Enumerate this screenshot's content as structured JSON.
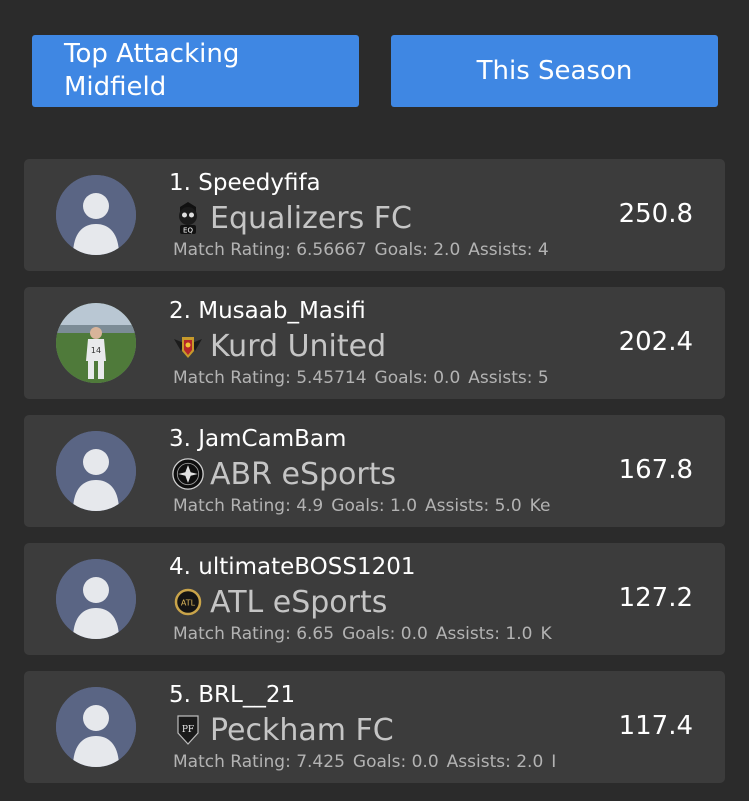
{
  "filters": {
    "position_label": "Top Attacking Midfield",
    "period_label": "This Season"
  },
  "players": [
    {
      "name": "1. Speedyfifa",
      "club": "Equalizers FC",
      "club_icon": "skull-crest-icon",
      "avatar": "default-avatar",
      "match_rating": "Match Rating: 6.56667",
      "goals": "Goals: 2.0",
      "assists": "Assists: 4",
      "score": "250.8"
    },
    {
      "name": "2. Musaab_Masifi",
      "club": "Kurd United",
      "club_icon": "winged-crest-icon",
      "avatar": "photo-avatar",
      "match_rating": "Match Rating: 5.45714",
      "goals": "Goals: 0.0",
      "assists": "Assists: 5",
      "score": "202.4"
    },
    {
      "name": "3. JamCamBam",
      "club": "ABR eSports",
      "club_icon": "round-black-crest-icon",
      "avatar": "default-avatar",
      "match_rating": "Match Rating: 4.9",
      "goals": "Goals: 1.0",
      "assists": "Assists: 5.0",
      "extra": "Ke",
      "score": "167.8"
    },
    {
      "name": "4. ultimateBOSS1201",
      "club": "ATL eSports",
      "club_icon": "gold-ring-crest-icon",
      "avatar": "default-avatar",
      "match_rating": "Match Rating: 6.65",
      "goals": "Goals: 0.0",
      "assists": "Assists: 1.0",
      "extra": "K",
      "score": "127.2"
    },
    {
      "name": "5. BRL__21",
      "club": "Peckham FC",
      "club_icon": "pfc-monogram-crest-icon",
      "avatar": "default-avatar",
      "match_rating": "Match Rating: 7.425",
      "goals": "Goals: 0.0",
      "assists": "Assists: 2.0",
      "extra": "I",
      "score": "117.4"
    }
  ],
  "colors": {
    "background": "#2b2b2b",
    "card": "#3c3c3c",
    "accent": "#3f87e3",
    "avatar_bg": "#5a6584"
  }
}
